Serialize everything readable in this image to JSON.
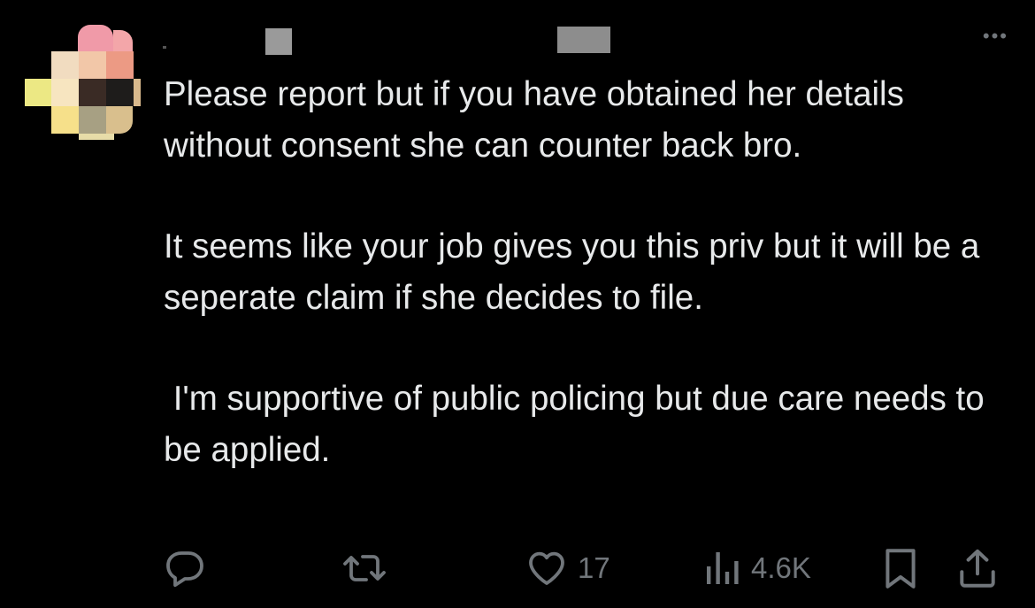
{
  "colors": {
    "background": "#000000",
    "text": "#e7e9ea",
    "secondary": "#71767b"
  },
  "header": {
    "more_icon": "more-dots-icon",
    "more_label": "•••"
  },
  "body": {
    "paragraphs": [
      "Please report but if you have obtained her details without consent she can counter back bro.",
      "It seems like your job gives you this priv but it will be a seperate claim if she decides to file.",
      " I'm supportive of public policing but due care needs to be applied."
    ]
  },
  "actions": {
    "reply": {
      "icon": "reply-icon"
    },
    "repost": {
      "icon": "repost-icon"
    },
    "like": {
      "icon": "heart-icon",
      "count": "17"
    },
    "views": {
      "icon": "views-chart-icon",
      "count": "4.6K"
    },
    "bookmark": {
      "icon": "bookmark-icon"
    },
    "share": {
      "icon": "share-icon"
    }
  }
}
